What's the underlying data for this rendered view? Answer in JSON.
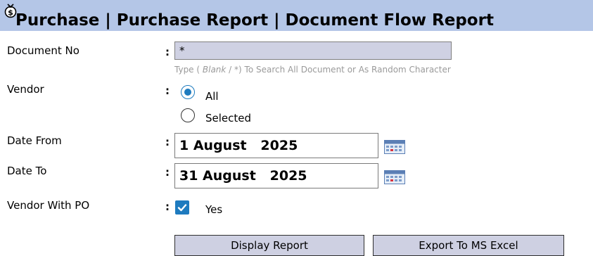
{
  "header": {
    "title": "Purchase | Purchase Report | Document Flow Report",
    "icon": "money-bag-icon",
    "background": "#b4c6e7"
  },
  "form": {
    "document_no": {
      "label": "Document No",
      "value": "*",
      "hint_prefix": "Type ( ",
      "hint_italic": "Blank",
      "hint_suffix": " / *) To Search All Document or As Random Character"
    },
    "vendor": {
      "label": "Vendor",
      "options": [
        {
          "label": "All",
          "selected": true
        },
        {
          "label": "Selected",
          "selected": false
        }
      ]
    },
    "date_from": {
      "label": "Date From",
      "value": "1 August   2025"
    },
    "date_to": {
      "label": "Date To",
      "value": "31 August   2025"
    },
    "vendor_with_po": {
      "label": "Vendor With PO",
      "checkbox_label": "Yes",
      "checked": true
    },
    "colon": ":"
  },
  "buttons": {
    "display": "Display Report",
    "export": "Export To MS Excel"
  },
  "colors": {
    "input_bg": "#cfd1e3",
    "button_bg": "#ced0e2",
    "accent": "#1e7bbf",
    "hint": "#9a9a9a"
  }
}
